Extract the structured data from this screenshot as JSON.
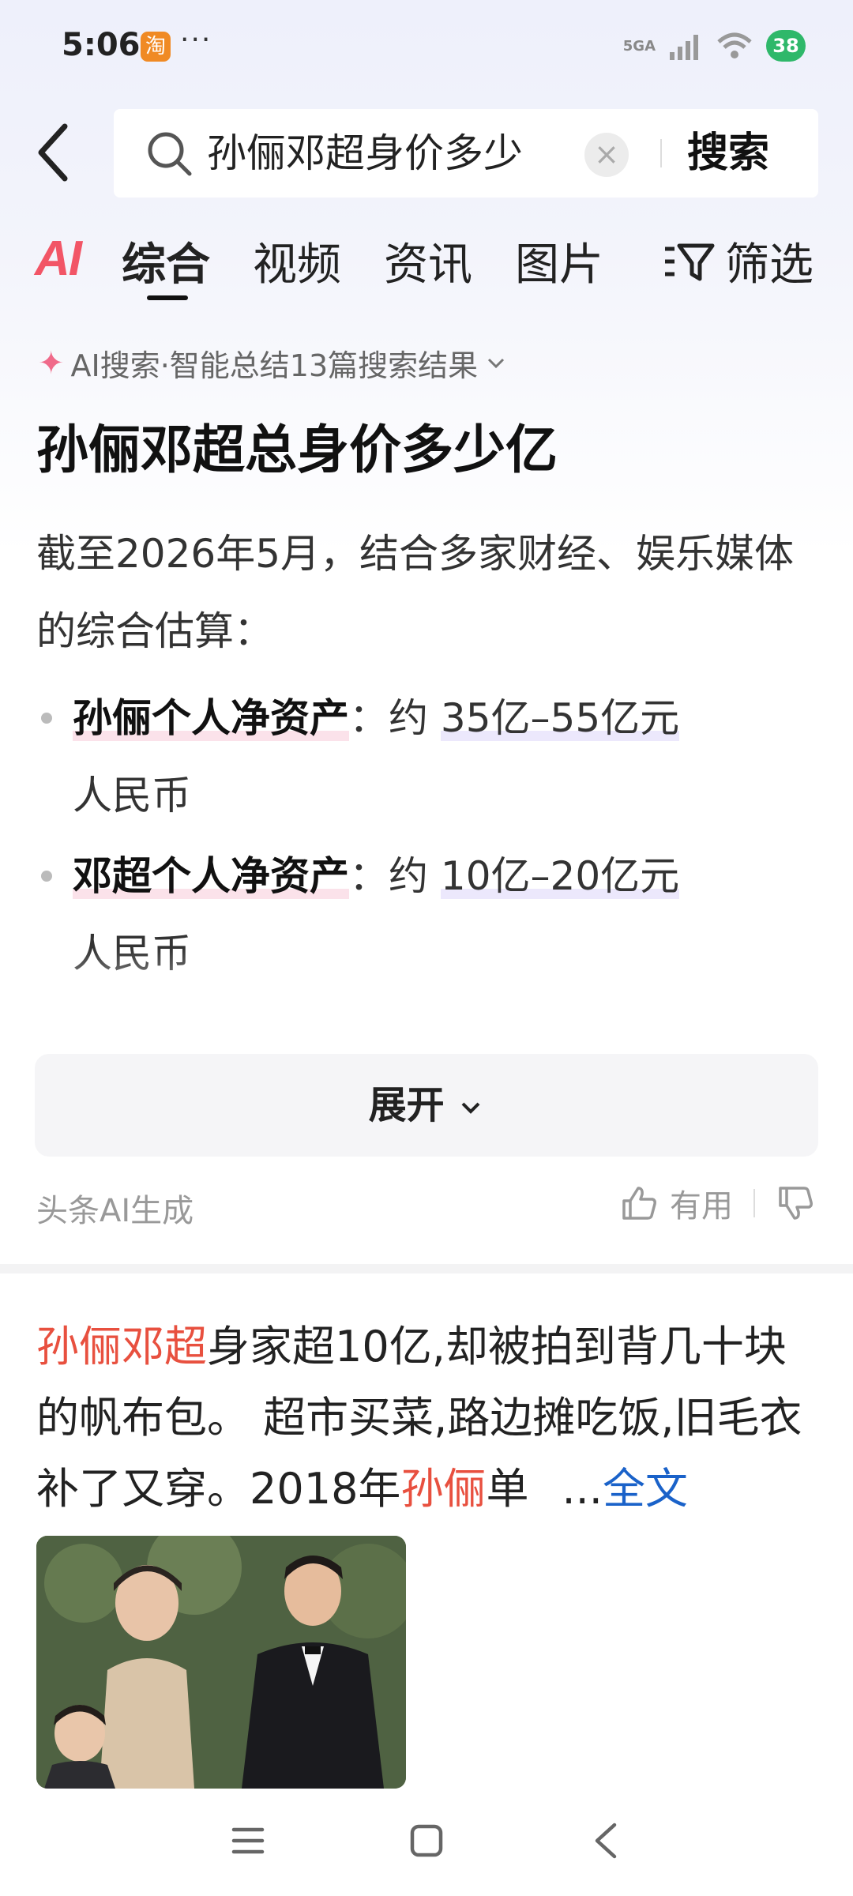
{
  "status_bar": {
    "time": "5:06",
    "app_icon": "淘",
    "dots": "···",
    "signal": "5GA",
    "battery": "38"
  },
  "search": {
    "query": "孙俪邓超身价多少",
    "clear": "×",
    "button": "搜索"
  },
  "tabs": {
    "ai": "AI",
    "items": [
      "综合",
      "视频",
      "资讯",
      "图片"
    ],
    "filter": "筛选"
  },
  "ai_summary": {
    "meta": "AI搜索·智能总结13篇搜索结果",
    "title": "孙俪邓超总身价多少亿",
    "intro": "截至2026年5月，结合多家财经、娱乐媒体的综合估算：",
    "bullets": [
      {
        "label": "孙俪个人净资产",
        "sep": "：约 ",
        "value": "35亿–55亿元",
        "tail": "人民币"
      },
      {
        "label": "邓超个人净资产",
        "sep": "：约 ",
        "value": "10亿–20亿元",
        "tail": "人民币"
      }
    ],
    "expand": "展开",
    "source": "头条AI生成",
    "useful": "有用"
  },
  "article": {
    "hl1": "孙俪邓超",
    "text1": "身家超10亿,却被拍到背几十块的帆布包。 超市买菜,路边摊吃饭,旧毛衣补了又穿。2018年",
    "hl2": "孙俪",
    "text2": "单",
    "ellipsis": "...",
    "full": "全文"
  },
  "colors": {
    "accent_red": "#e8503f",
    "link_blue": "#1a62c9",
    "ai_pink": "#f25566"
  }
}
